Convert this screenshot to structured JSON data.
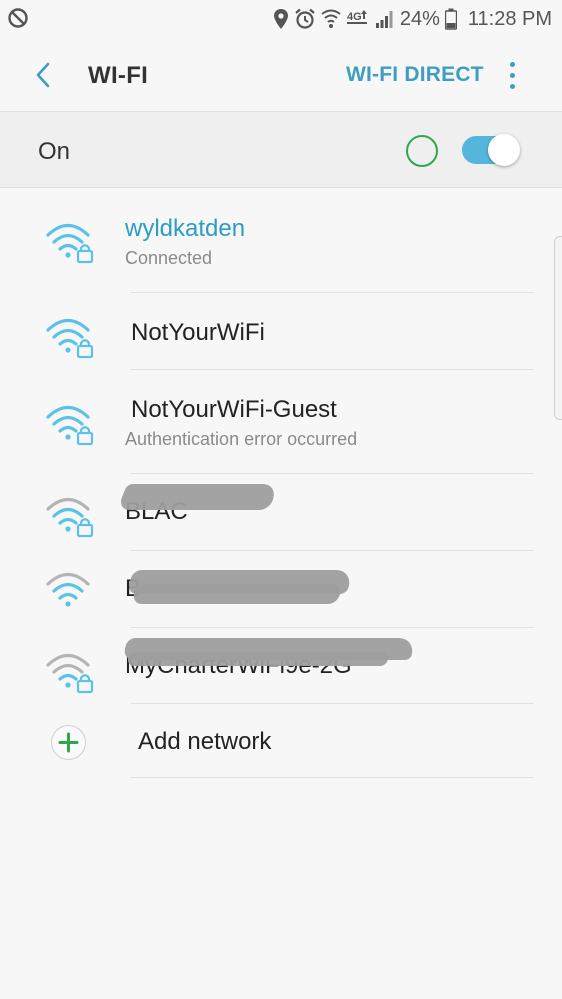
{
  "status_bar": {
    "dnd_icon": "do-not-disturb-icon",
    "icons": [
      "location-icon",
      "alarm-icon",
      "wifi-calling-icon",
      "4g-lte-icon",
      "signal-icon"
    ],
    "battery_percent": "24%",
    "time": "11:28 PM"
  },
  "app_bar": {
    "title": "WI-FI",
    "action_label": "WI-FI DIRECT"
  },
  "master_switch": {
    "label": "On",
    "enabled": true
  },
  "networks": [
    {
      "name": "wyldkatden",
      "status": "Connected",
      "secured": true,
      "signal": "full",
      "connected": true
    },
    {
      "name": "NotYourWiFi",
      "status": "",
      "secured": true,
      "signal": "full",
      "connected": false
    },
    {
      "name": "NotYourWiFi-Guest",
      "status": "Authentication error occurred",
      "secured": true,
      "signal": "full",
      "connected": false
    },
    {
      "name": "BLAC",
      "status": "",
      "secured": true,
      "signal": "medium",
      "connected": false,
      "redacted": true
    },
    {
      "name": "B",
      "status": "",
      "secured": false,
      "signal": "medium",
      "connected": false,
      "redacted": true
    },
    {
      "name": "MyCharterWiFi9e-2G",
      "status": "",
      "secured": true,
      "signal": "low",
      "connected": false,
      "redacted": true
    }
  ],
  "add_network": {
    "label": "Add network",
    "icon": "plus-icon"
  },
  "colors": {
    "accent": "#3f9dc1",
    "connected_text": "#2d9cc6",
    "wifi_full": "#5cc1e9",
    "toggle_track": "#55b6dc",
    "scan_ring": "#2ea84d",
    "plus": "#2ea84d"
  }
}
